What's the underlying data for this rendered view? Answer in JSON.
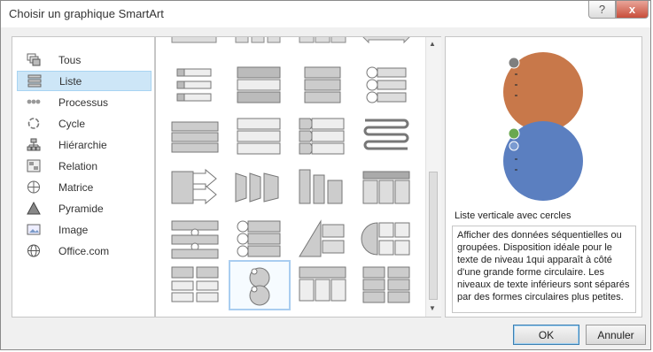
{
  "window": {
    "title": "Choisir un graphique SmartArt",
    "help_label": "?",
    "close_label": "x"
  },
  "categories": [
    {
      "label": "Tous",
      "icon": "all-layouts-icon",
      "selected": false
    },
    {
      "label": "Liste",
      "icon": "list-icon",
      "selected": true
    },
    {
      "label": "Processus",
      "icon": "process-icon",
      "selected": false
    },
    {
      "label": "Cycle",
      "icon": "cycle-icon",
      "selected": false
    },
    {
      "label": "Hiérarchie",
      "icon": "hierarchy-icon",
      "selected": false
    },
    {
      "label": "Relation",
      "icon": "relationship-icon",
      "selected": false
    },
    {
      "label": "Matrice",
      "icon": "matrix-icon",
      "selected": false
    },
    {
      "label": "Pyramide",
      "icon": "pyramid-icon",
      "selected": false
    },
    {
      "label": "Image",
      "icon": "picture-icon",
      "selected": false
    },
    {
      "label": "Office.com",
      "icon": "globe-icon",
      "selected": false
    }
  ],
  "preview": {
    "title": "Liste verticale avec cercles",
    "description": "Afficher des données séquentielles ou groupées. Disposition idéale pour le texte de niveau 1qui apparaît à côté d'une grande forme circulaire. Les niveaux de texte inférieurs sont séparés par des formes circulaires plus petites.",
    "colors": {
      "top_circle": "#c8784a",
      "bottom_circle": "#5b7fc0",
      "small_dot_1": "#7f7f7f",
      "small_dot_2": "#6aa84f",
      "small_dot_3": "#7b9bd1"
    }
  },
  "buttons": {
    "ok": "OK",
    "cancel": "Annuler"
  },
  "accent": {
    "selection": "#cde6f7",
    "close": "#c84e3b"
  }
}
